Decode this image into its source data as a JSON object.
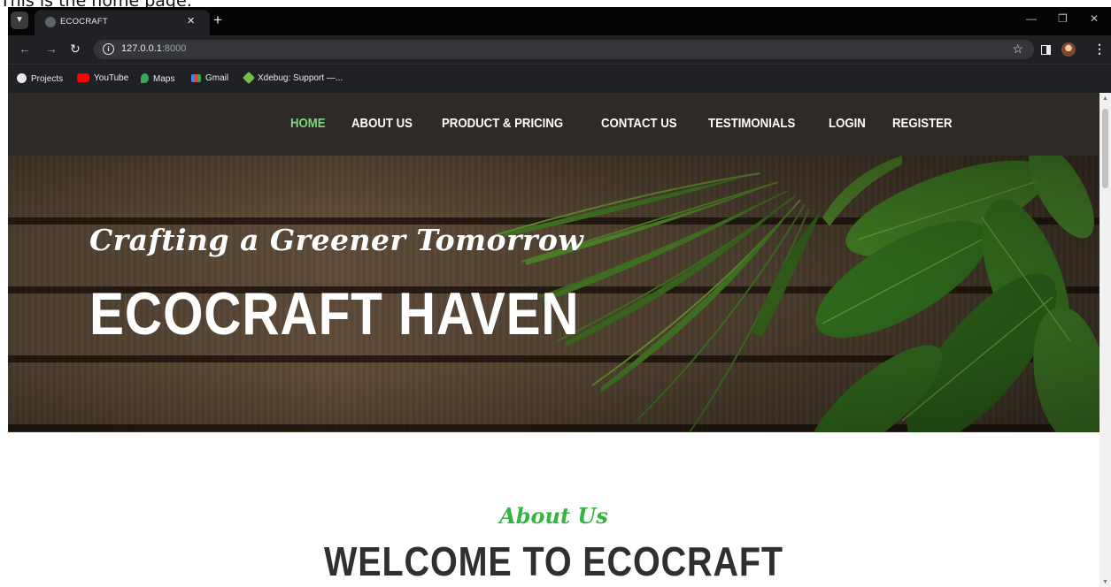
{
  "caption": "This is the home page:",
  "browser": {
    "tab_title": "ECOCRAFT",
    "url_host": "127.0.0.1",
    "url_port": ":8000",
    "bookmarks": [
      {
        "label": "Projects",
        "icon": "globe-icon",
        "color": "#e8eaed"
      },
      {
        "label": "YouTube",
        "icon": "youtube-icon",
        "color": "#ff0000"
      },
      {
        "label": "Maps",
        "icon": "maps-icon",
        "color": "#34a853"
      },
      {
        "label": "Gmail",
        "icon": "gmail-icon",
        "color": "#ea4335"
      },
      {
        "label": "Xdebug: Support —...",
        "icon": "xdebug-icon",
        "color": "#6fbf4a"
      }
    ]
  },
  "nav": {
    "items": [
      "HOME",
      "ABOUT US",
      "PRODUCT & PRICING",
      "CONTACT US",
      "TESTIMONIALS",
      "LOGIN",
      "REGISTER"
    ],
    "active_index": 0,
    "active_color": "#7ad67a"
  },
  "hero": {
    "tagline": "Crafting a Greener Tomorrow",
    "title": "ECOCRAFT HAVEN"
  },
  "about": {
    "subtitle": "About Us",
    "title": "WELCOME TO ECOCRAFT"
  },
  "colors": {
    "nav_bg": "#2e2a27",
    "accent_green": "#35b53f"
  }
}
